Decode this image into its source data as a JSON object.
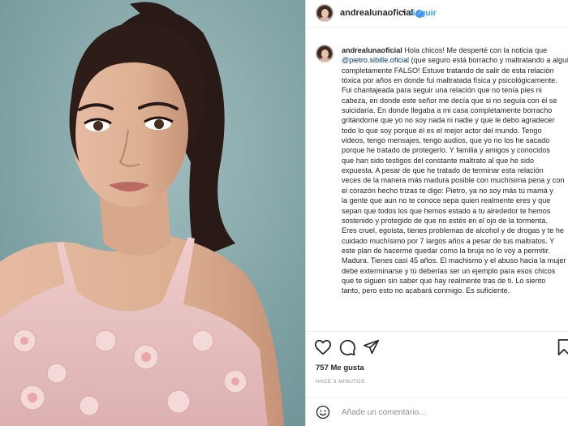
{
  "post": {
    "username": "andrealunaoficial",
    "separator": "•",
    "follow_label": "Seguir",
    "caption_lines": [
      [
        {
          "t": "andrealunaoficial",
          "c": "u"
        },
        {
          "t": " Hola chicos! Me desperté con la noticia que "
        }
      ],
      [
        {
          "t": "@pietro.sibille.oficial",
          "c": "m"
        },
        {
          "t": " (que seguro está borracho y maltratando a alguien) dijo que yo supuestamente le fui \"infiel\" Esto es"
        }
      ],
      [
        {
          "t": "completamente FALSO! Estuve tratando de salir de esta relación"
        }
      ],
      [
        {
          "t": "tóxica por años en donde fui maltratada física y psicológicamente."
        }
      ],
      [
        {
          "t": "Fui chantajeada para seguir una relación que no tenía pies ni"
        }
      ],
      [
        {
          "t": "cabeza, en donde este señor me decía que si no seguía con él se"
        }
      ],
      [
        {
          "t": "suicidaría. En donde llegaba a mi casa completamente borracho"
        }
      ],
      [
        {
          "t": "gritándome que yo no soy nada ni nadie y que le debo agradecer"
        }
      ],
      [
        {
          "t": "todo lo que soy porque él es el mejor actor del mundo. Tengo"
        }
      ],
      [
        {
          "t": "videos, tengo mensajes, tengo audios, que yo no los he sacado"
        }
      ],
      [
        {
          "t": "porque he tratado de protegerlo. Y familia y amigos y conocidos"
        }
      ],
      [
        {
          "t": "que han sido testigos del constante maltrato al que he sido"
        }
      ],
      [
        {
          "t": "expuesta. A pesar de que he tratado de terminar esta relación"
        }
      ],
      [
        {
          "t": "veces de la manera más madura posible con muchísima pena y con"
        }
      ],
      [
        {
          "t": "el corazón hecho trizas te digo: Pietro, ya no soy más tú mamá y"
        }
      ],
      [
        {
          "t": "la gente que aun no te conoce sepa quien realmente eres y que"
        }
      ],
      [
        {
          "t": "sepan que todos los que hemos estado a tu alrededor te hemos"
        }
      ],
      [
        {
          "t": "sostenido y protegido de que no estés en el ojo de la tormenta."
        }
      ],
      [
        {
          "t": "Eres cruel, egoísta, tienes problemas de alcohol y de drogas y te he"
        }
      ],
      [
        {
          "t": "cuidado muchísimo por 7 largos años a pesar de tus maltratos. Y"
        }
      ],
      [
        {
          "t": "este plan de hacerme quedar como la bruja no lo voy a permitir."
        }
      ],
      [
        {
          "t": "Madura. Tienes casi 45 años. El machismo y el abuso hacia la mujer"
        }
      ],
      [
        {
          "t": "debe exterminarse y tú deberías ser un ejemplo para esos chicos"
        }
      ],
      [
        {
          "t": "que te siguen sin saber que hay realmente tras de ti. Lo siento"
        }
      ],
      [
        {
          "t": "tanto, pero esto no acabará conmigo. Es suficiente."
        }
      ]
    ],
    "likes": "757 Me gusta",
    "time_ago": "HACE 3 MINUTOS",
    "comment_placeholder": "Añade un comentario..."
  },
  "icons": [
    "heart-icon",
    "comment-icon",
    "share-icon",
    "bookmark-icon",
    "emoji-icon",
    "verified-badge-icon"
  ],
  "colors": {
    "link": "#3897f0",
    "text": "#262626",
    "muted": "#8e8e8e",
    "photo_bg": "#86a9ab",
    "dress": "#e8c1c0"
  }
}
